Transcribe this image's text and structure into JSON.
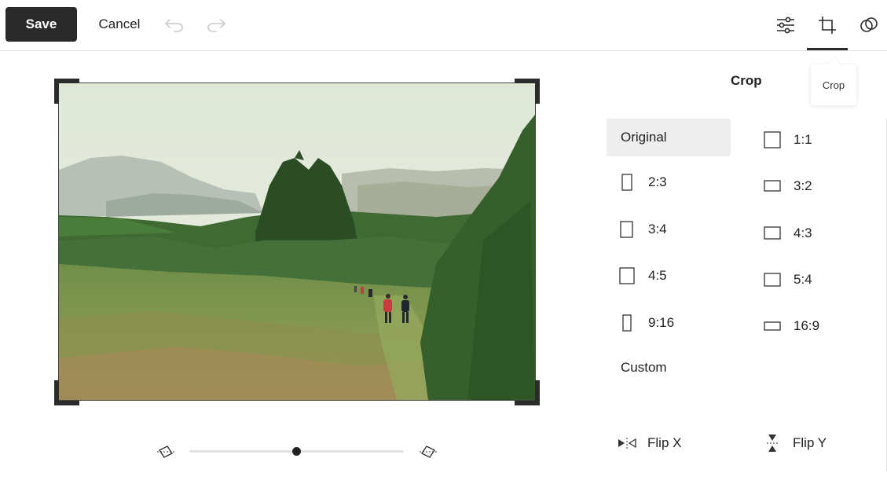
{
  "toolbar": {
    "save_label": "Save",
    "cancel_label": "Cancel",
    "undo_icon": "undo-icon",
    "redo_icon": "redo-icon",
    "tools": [
      "adjust-sliders-icon",
      "crop-icon",
      "filters-circles-icon"
    ],
    "active_tool": "crop-icon",
    "tooltip": "Crop"
  },
  "panel": {
    "title": "Crop",
    "left_options": [
      {
        "label": "Original",
        "selected": true
      },
      {
        "label": "2:3"
      },
      {
        "label": "3:4"
      },
      {
        "label": "4:5"
      },
      {
        "label": "9:16"
      },
      {
        "label": "Custom"
      }
    ],
    "right_options": [
      {
        "label": "1:1"
      },
      {
        "label": "3:2"
      },
      {
        "label": "4:3"
      },
      {
        "label": "5:4"
      },
      {
        "label": "16:9"
      }
    ],
    "flip_x": "Flip X",
    "flip_y": "Flip Y"
  },
  "straighten": {
    "value": 0.5,
    "left_icon": "rotate-left-icon",
    "right_icon": "rotate-right-icon"
  },
  "colors": {
    "primary_button": "#2a2a2a",
    "selected_option_bg": "#eeeeee",
    "slider_track": "#e2e2e2"
  }
}
